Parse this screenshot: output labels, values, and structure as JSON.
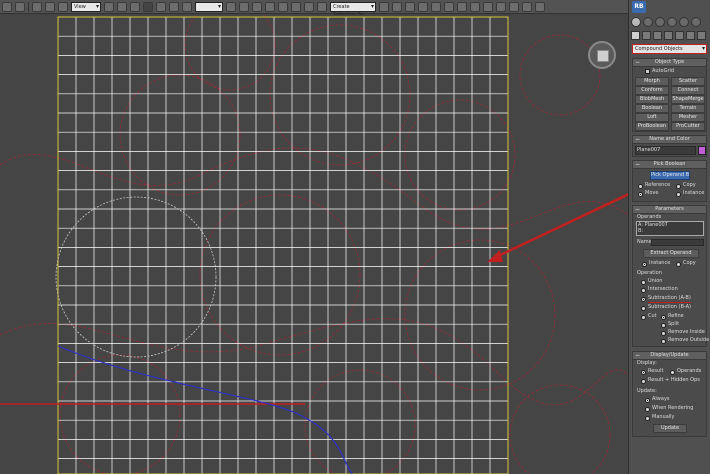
{
  "toolbar": {
    "selection_filter": "View",
    "named_selection": "Create Selection Se",
    "icons": [
      "undo-icon",
      "redo-icon",
      "select-link-icon",
      "unlink-icon",
      "bind-spacewarp-icon",
      "selection-filter-dropdown",
      "select-object-icon",
      "select-by-name-icon",
      "select-region-icon",
      "window-crossing-icon",
      "select-move-icon",
      "select-rotate-icon",
      "select-scale-icon",
      "reference-coord-dropdown",
      "pivot-icon",
      "manipulate-icon",
      "keyboard-shortcut-icon",
      "snaps-toggle-icon",
      "angle-snap-icon",
      "percent-snap-icon",
      "spinner-snap-icon",
      "edit-named-selection-icon",
      "named-selection-dropdown",
      "mirror-icon",
      "align-icon",
      "layer-manager-icon",
      "graphite-ribbon-icon",
      "curve-editor-icon",
      "schematic-view-icon",
      "material-editor-icon",
      "render-setup-icon",
      "rendered-frame-icon",
      "render-icon"
    ]
  },
  "panel": {
    "badge": "RB",
    "category": "Compound Objects",
    "object_type": {
      "title": "Object Type",
      "autogrid": "AutoGrid",
      "buttons": [
        [
          "Morph",
          "Scatter"
        ],
        [
          "Conform",
          "Connect"
        ],
        [
          "BlobMesh",
          "ShapeMerge"
        ],
        [
          "Boolean",
          "Terrain"
        ],
        [
          "Loft",
          "Mesher"
        ],
        [
          "ProBoolean",
          "ProCutter"
        ]
      ]
    },
    "name_color": {
      "title": "Name and Color",
      "name": "Plane007",
      "swatch": "#c25fd6"
    },
    "pick_boolean": {
      "title": "Pick Boolean",
      "pick_button": "Pick Operand B",
      "reference": "Reference",
      "copy": "Copy",
      "move": "Move",
      "instance": "Instance"
    },
    "parameters": {
      "title": "Parameters",
      "operands_label": "Operands",
      "operand_a": "A: Plane007",
      "operand_b": "B:",
      "name_label": "Name:",
      "extract": "Extract Operand",
      "instance": "Instance",
      "copy": "Copy",
      "operation_label": "Operation",
      "ops": [
        "Union",
        "Intersection",
        "Subtraction (A-B)",
        "Subtraction (B-A)"
      ],
      "cut": "Cut",
      "cut_options": [
        "Refine",
        "Split",
        "Remove Inside",
        "Remove Outside"
      ]
    },
    "display_update": {
      "title": "Display/Update",
      "display_label": "Display:",
      "result": "Result",
      "operands": "Operands",
      "result_hidden": "Result + Hidden Ops",
      "update_label": "Update:",
      "always": "Always",
      "when_rendering": "When Rendering",
      "manually": "Manually",
      "update_button": "Update"
    }
  },
  "colors": {
    "grid_line": "#ffffff",
    "mesh_border": "#d8c63a",
    "spline": "#9a2a38",
    "circle": "#c9c9c9",
    "highlight_red": "#c02020",
    "blue_line": "#3030c8",
    "accent_blue": "#3a6bb0"
  }
}
